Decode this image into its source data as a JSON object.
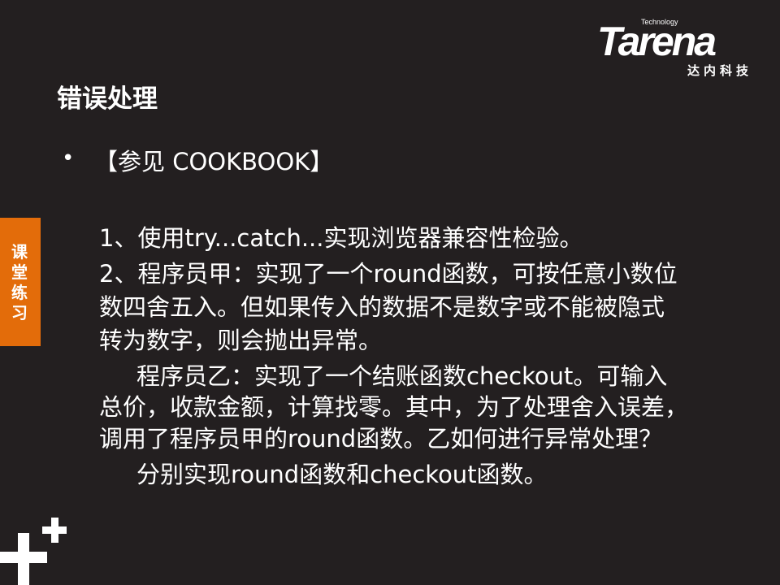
{
  "logo": {
    "technology": "Technology",
    "brand": "Tarena",
    "chinese": "达内科技"
  },
  "title": "错误处理",
  "bullet": "•",
  "reference": "【参见 COOKBOOK】",
  "side_tab": "课堂练习",
  "lines": [
    "1、使用try...catch...实现浏览器兼容性检验。",
    "2、程序员甲：实现了一个round函数，可按任意小数位",
    "数四舍五入。但如果传入的数据不是数字或不能被隐式",
    "转为数字，则会抛出异常。",
    "程序员乙：实现了一个结账函数checkout。可输入",
    "总价，收款金额，计算找零。其中，为了处理舍入误差，",
    "调用了程序员甲的round函数。乙如何进行异常处理？",
    "分别实现round函数和checkout函数。"
  ],
  "colors": {
    "background": "#231f20",
    "accent": "#e36c0a"
  }
}
